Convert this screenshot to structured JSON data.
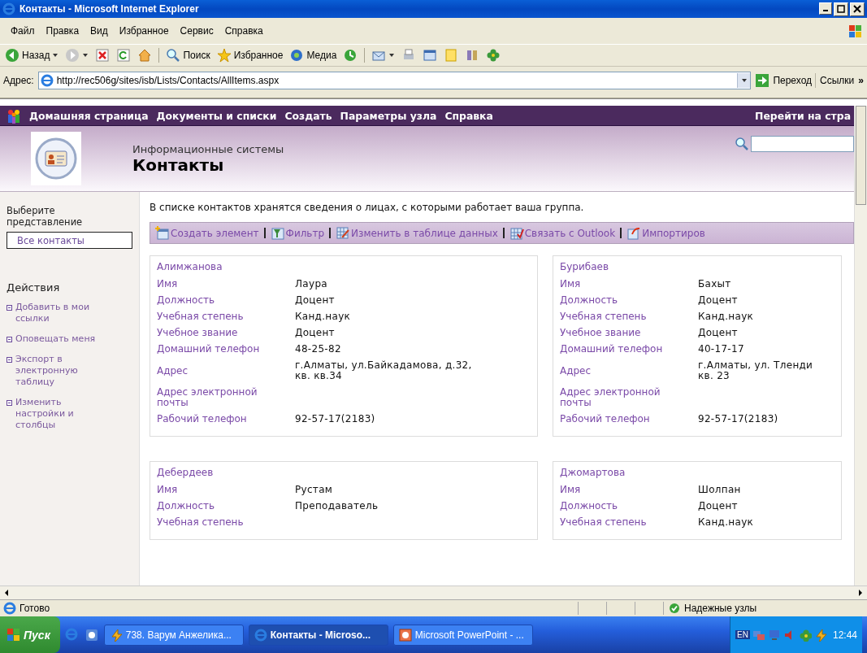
{
  "window": {
    "title": "Контакты - Microsoft Internet Explorer"
  },
  "menu": [
    "Файл",
    "Правка",
    "Вид",
    "Избранное",
    "Сервис",
    "Справка"
  ],
  "toolbar": [
    "Назад",
    "Поиск",
    "Избранное",
    "Медиа"
  ],
  "address": {
    "label": "Адрес:",
    "url": "http://rec506g/sites/isb/Lists/Contacts/AllItems.aspx",
    "go": "Переход",
    "links": "Ссылки",
    "more": "»"
  },
  "nav": {
    "items": [
      "Домашняя страница",
      "Документы и списки",
      "Создать",
      "Параметры узла",
      "Справка"
    ],
    "right": "Перейти на стра"
  },
  "header": {
    "site": "Информационные системы",
    "title": "Контакты"
  },
  "sidebar": {
    "views_heading": "Выберите представление",
    "view": "Все контакты",
    "actions_heading": "Действия",
    "actions": [
      "Добавить в мои ссылки",
      "Оповещать меня",
      "Экспорт в электронную таблицу",
      "Изменить настройки и столбцы"
    ]
  },
  "description": "В списке контактов хранятся сведения о лицах, с которыми работает ваша группа.",
  "actions": [
    "Создать элемент",
    "Фильтр",
    "Изменить в таблице данных",
    "Связать с Outlook",
    "Импортиров"
  ],
  "cards": [
    {
      "title": "Алимжанова",
      "fields": [
        {
          "label": "Имя",
          "value": "Лаура"
        },
        {
          "label": "Должность",
          "value": "Доцент"
        },
        {
          "label": "Учебная степень",
          "value": "Канд.наук"
        },
        {
          "label": "Учебное звание",
          "value": "Доцент"
        },
        {
          "label": "Домашний телефон",
          "value": "48-25-82"
        },
        {
          "label": "Адрес",
          "value": "г.Алматы,  ул.Байкадамова, д.32,\nкв. кв.34"
        },
        {
          "label": "Адрес электронной почты"
        },
        {
          "label": "Рабочий телефон",
          "value": "92-57-17(2183)"
        }
      ]
    },
    {
      "title": "Бурибаев",
      "fields": [
        {
          "label": "Имя",
          "value": "Бахыт"
        },
        {
          "label": "Должность",
          "value": "Доцент"
        },
        {
          "label": "Учебная степень",
          "value": "Канд.наук"
        },
        {
          "label": "Учебное звание",
          "value": "Доцент"
        },
        {
          "label": "Домашний телефон",
          "value": "40-17-17"
        },
        {
          "label": "Адрес",
          "value": "г.Алматы, ул. Тленди\nкв. 23"
        },
        {
          "label": "Адрес электронной почты"
        },
        {
          "label": "Рабочий телефон",
          "value": "92-57-17(2183)"
        }
      ]
    },
    {
      "title": "Дебердеев",
      "fields": [
        {
          "label": "Имя",
          "value": "Рустам"
        },
        {
          "label": "Должность",
          "value": "Преподаватель"
        },
        {
          "label": "Учебная степень"
        }
      ]
    },
    {
      "title": "Джомартова",
      "fields": [
        {
          "label": "Имя",
          "value": "Шолпан"
        },
        {
          "label": "Должность",
          "value": "Доцент"
        },
        {
          "label": "Учебная степень",
          "value": "Канд.наук"
        }
      ]
    }
  ],
  "status_bar": {
    "text": "Готово",
    "zone": "Надежные узлы"
  },
  "taskbar": {
    "start": "Пуск",
    "tasks": [
      {
        "label": "738. Варум Анжелика...",
        "selected": false
      },
      {
        "label": "Контакты - Microso...",
        "selected": true
      },
      {
        "label": "Microsoft PowerPoint - ...",
        "selected": false
      }
    ],
    "lang": "EN",
    "clock": "12:44"
  }
}
